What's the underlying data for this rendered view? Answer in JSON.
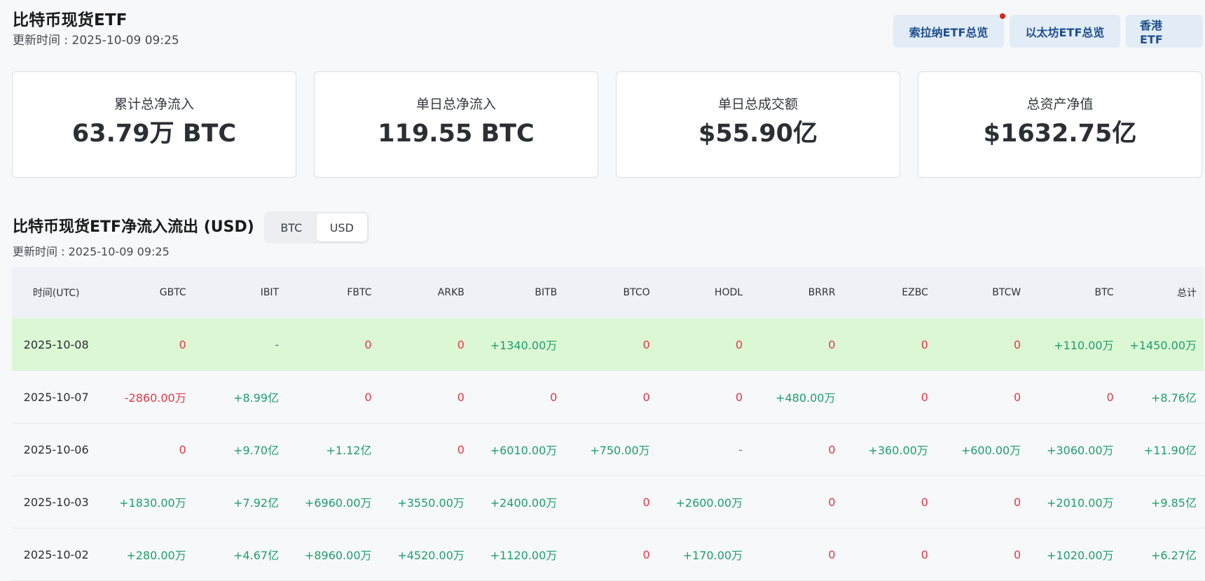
{
  "header": {
    "title": "比特币现货ETF",
    "update_label": "更新时间 : 2025-10-09 09:25"
  },
  "nav_buttons": [
    {
      "label": "索拉纳ETF总览",
      "has_dot": true
    },
    {
      "label": "以太坊ETF总览"
    },
    {
      "label": "香港 ETF"
    }
  ],
  "stats": [
    {
      "label": "累计总净流入",
      "value": "63.79万 BTC"
    },
    {
      "label": "单日总净流入",
      "value": "119.55 BTC"
    },
    {
      "label": "单日总成交额",
      "value": "$55.90亿"
    },
    {
      "label": "总资产净值",
      "value": "$1632.75亿"
    }
  ],
  "section": {
    "title": "比特币现货ETF净流入流出 (USD)",
    "update_label": "更新时间 : 2025-10-09 09:25",
    "toggle": {
      "options": [
        "BTC",
        "USD"
      ],
      "selected": "USD"
    }
  },
  "colors": {
    "positive": "#1e9e6e",
    "negative": "#e5384a",
    "highlight_row": "#dcf7d4",
    "nav_button_bg": "#e1ecf7"
  },
  "table": {
    "columns": [
      "时间(UTC)",
      "GBTC",
      "IBIT",
      "FBTC",
      "ARKB",
      "BITB",
      "BTCO",
      "HODL",
      "BRRR",
      "EZBC",
      "BTCW",
      "BTC",
      "总计"
    ],
    "rows": [
      {
        "date": "2025-10-08",
        "highlight": true,
        "cells": [
          "0",
          "-",
          "0",
          "0",
          "+1340.00万",
          "0",
          "0",
          "0",
          "0",
          "0",
          "+110.00万",
          "+1450.00万"
        ]
      },
      {
        "date": "2025-10-07",
        "cells": [
          "-2860.00万",
          "+8.99亿",
          "0",
          "0",
          "0",
          "0",
          "0",
          "+480.00万",
          "0",
          "0",
          "0",
          "+8.76亿"
        ]
      },
      {
        "date": "2025-10-06",
        "cells": [
          "0",
          "+9.70亿",
          "+1.12亿",
          "0",
          "+6010.00万",
          "+750.00万",
          "-",
          "0",
          "+360.00万",
          "+600.00万",
          "+3060.00万",
          "+11.90亿"
        ]
      },
      {
        "date": "2025-10-03",
        "cells": [
          "+1830.00万",
          "+7.92亿",
          "+6960.00万",
          "+3550.00万",
          "+2400.00万",
          "0",
          "+2600.00万",
          "0",
          "0",
          "0",
          "+2010.00万",
          "+9.85亿"
        ]
      },
      {
        "date": "2025-10-02",
        "cells": [
          "+280.00万",
          "+4.67亿",
          "+8960.00万",
          "+4520.00万",
          "+1120.00万",
          "0",
          "+170.00万",
          "0",
          "0",
          "0",
          "+1020.00万",
          "+6.27亿"
        ]
      }
    ]
  }
}
